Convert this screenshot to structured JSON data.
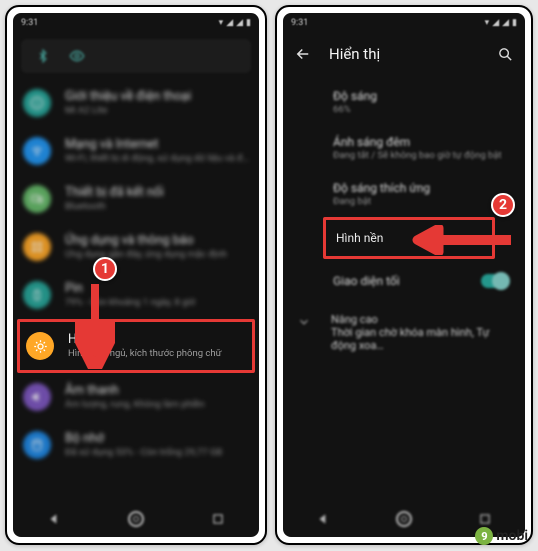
{
  "statusbar": {
    "time": "9:31"
  },
  "left": {
    "items": [
      {
        "title": "Giới thiệu về điện thoại",
        "sub": "Mi A2 Lite"
      },
      {
        "title": "Mạng và Internet",
        "sub": "Wi-Fi, thiết bị di động, sử dụng dữ liệu và điểm phát sóng"
      },
      {
        "title": "Thiết bị đã kết nối",
        "sub": "Bluetooth"
      },
      {
        "title": "Ứng dụng và thông báo",
        "sub": "Ứng dụng gần đây, ứng dụng mặc định"
      },
      {
        "title": "Pin",
        "sub": "79% - Còn khoảng 1 ngày, 8 giờ"
      },
      {
        "title": "Hiển thị",
        "sub": "Hình nền, ngủ, kích thước phông chữ"
      },
      {
        "title": "Âm thanh",
        "sub": "Âm lượng, rung, Không làm phiền"
      },
      {
        "title": "Bộ nhớ",
        "sub": "Đã sử dụng 53% - Còn trống 29,77 GB"
      }
    ]
  },
  "right": {
    "header_title": "Hiển thị",
    "items": {
      "brightness": {
        "title": "Độ sáng",
        "sub": "66%"
      },
      "nightlight": {
        "title": "Ánh sáng đêm",
        "sub": "Đang tắt / Sẽ không bao giờ tự động bật"
      },
      "adaptive": {
        "title": "Độ sáng thích ứng",
        "sub": "Đang bật"
      },
      "wallpaper": {
        "title": "Hình nền"
      },
      "darktheme": {
        "title": "Giao diện tối"
      },
      "advanced": {
        "title": "Nâng cao",
        "sub": "Thời gian chờ khóa màn hình, Tự động xoa…"
      }
    }
  },
  "annotations": {
    "step1": "1",
    "step2": "2"
  },
  "watermark": {
    "nine": "9",
    "mobi": "mobi"
  }
}
